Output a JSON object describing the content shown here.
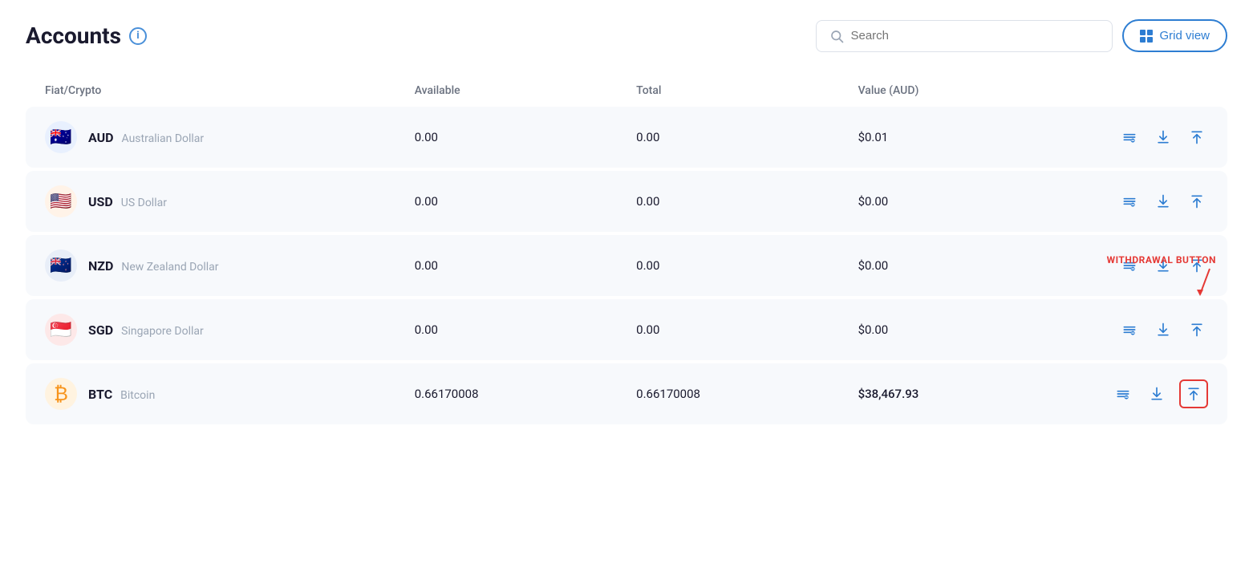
{
  "header": {
    "title": "Accounts",
    "info_icon_label": "i",
    "search_placeholder": "Search",
    "grid_view_label": "Grid view"
  },
  "table": {
    "columns": [
      "Fiat/Crypto",
      "Available",
      "Total",
      "Value (AUD)",
      ""
    ],
    "rows": [
      {
        "flag_emoji": "🇦🇺",
        "flag_class": "flag-aud",
        "code": "AUD",
        "name": "Australian Dollar",
        "available": "0.00",
        "total": "0.00",
        "value": "$0.01"
      },
      {
        "flag_emoji": "🇺🇸",
        "flag_class": "flag-usd",
        "code": "USD",
        "name": "US Dollar",
        "available": "0.00",
        "total": "0.00",
        "value": "$0.00"
      },
      {
        "flag_emoji": "🇳🇿",
        "flag_class": "flag-nzd",
        "code": "NZD",
        "name": "New Zealand Dollar",
        "available": "0.00",
        "total": "0.00",
        "value": "$0.00"
      },
      {
        "flag_emoji": "🇸🇬",
        "flag_class": "flag-sgd",
        "code": "SGD",
        "name": "Singapore Dollar",
        "available": "0.00",
        "total": "0.00",
        "value": "$0.00"
      },
      {
        "flag_emoji": "₿",
        "flag_class": "flag-btc",
        "code": "BTC",
        "name": "Bitcoin",
        "available": "0.66170008",
        "total": "0.66170008",
        "value": "$38,467.93",
        "is_btc": true
      }
    ],
    "actions": {
      "transfer_label": "transfer",
      "deposit_label": "deposit",
      "withdraw_label": "withdraw"
    }
  },
  "annotation": {
    "withdrawal_button_label": "WITHDRAWAL BUTTON"
  },
  "colors": {
    "accent": "#2d7dd2",
    "red": "#e53935"
  }
}
